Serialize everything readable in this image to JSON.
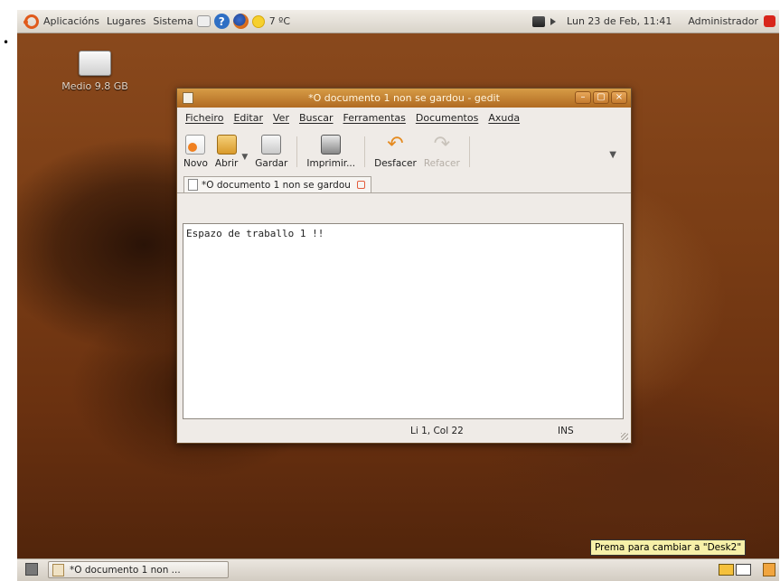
{
  "page": {
    "bullet": "•"
  },
  "top_panel": {
    "menus": [
      "Aplicacións",
      "Lugares",
      "Sistema"
    ],
    "weather": "7 ºC",
    "clock": "Lun 23 de Feb, 11:41",
    "user": "Administrador"
  },
  "desktop": {
    "drive_label": "Medio 9.8 GB"
  },
  "window": {
    "title": "*O documento 1 non se gardou - gedit",
    "buttons": {
      "minimize": "–",
      "maximize": "▢",
      "close": "×"
    },
    "menu": [
      "Ficheiro",
      "Editar",
      "Ver",
      "Buscar",
      "Ferramentas",
      "Documentos",
      "Axuda"
    ],
    "toolbar": {
      "new": "Novo",
      "open": "Abrir",
      "save": "Gardar",
      "print": "Imprimir...",
      "undo": "Desfacer",
      "redo": "Refacer"
    },
    "tab_label": "*O documento 1 non se gardou",
    "editor_text": "Espazo de traballo 1 !!",
    "status": {
      "position": "Li 1, Col 22",
      "mode": "INS"
    }
  },
  "bottom_panel": {
    "task_label": "*O documento 1 non ...",
    "tooltip": "Prema para cambiar a \"Desk2\""
  },
  "colors": {
    "title_bar": "#c58034",
    "accent": "#e05a1b",
    "tooltip_bg": "#f6f0a8",
    "desktop": "#7a3d15"
  }
}
